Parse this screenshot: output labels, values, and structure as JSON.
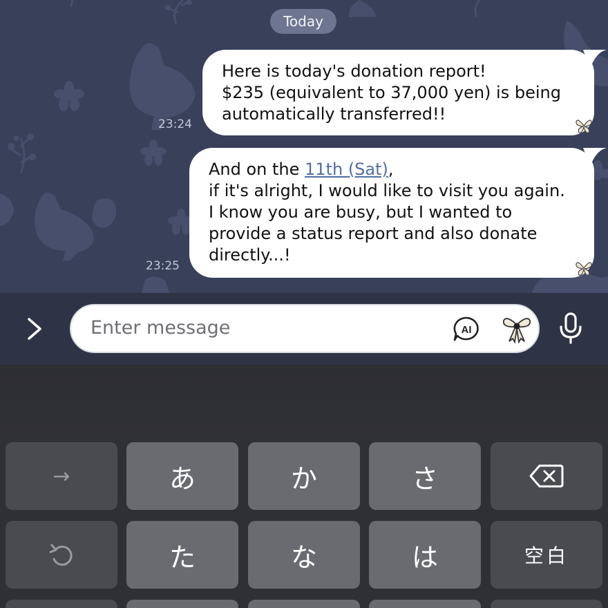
{
  "date_separator": "Today",
  "messages": [
    {
      "lines": [
        "Here is today's donation report!",
        "$235 (equivalent to 37,000 yen) is being",
        "automatically transferred!!"
      ],
      "time": "23:24"
    },
    {
      "line1_prefix": "And on the ",
      "line1_link": "11th (Sat)",
      "line1_suffix": ",",
      "lines": [
        "if it's alright, I would like to visit you again.",
        "I know you are busy, but I wanted to",
        "provide a status report and also donate",
        "directly...!"
      ],
      "time": "23:25"
    }
  ],
  "input": {
    "placeholder": "Enter message",
    "ai_label": "AI"
  },
  "keyboard": {
    "row1": [
      "→",
      "あ",
      "か",
      "さ",
      "delete"
    ],
    "row2": [
      "undo",
      "た",
      "な",
      "は",
      "空白"
    ]
  },
  "colors": {
    "chat_bg": "#38405a",
    "bubble": "#ffffff",
    "link": "#4f6fa6",
    "keyboard_bg": "#2f3034",
    "key": "#6a6b70",
    "function_key": "#4a4b50"
  },
  "icons": [
    "expand-chevron-icon",
    "ai-icon",
    "bow-sticker-icon",
    "microphone-icon",
    "arrow-right-icon",
    "backspace-icon",
    "undo-icon",
    "butterfly-icon"
  ]
}
